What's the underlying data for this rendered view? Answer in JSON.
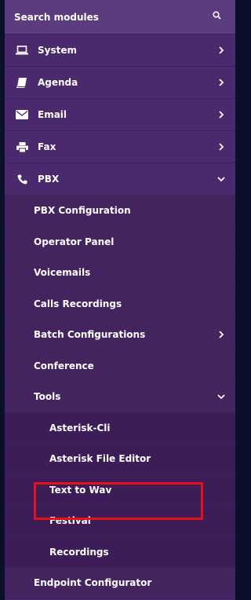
{
  "search": {
    "placeholder": "Search modules"
  },
  "top_items": [
    {
      "label": "System",
      "icon": "laptop-icon"
    },
    {
      "label": "Agenda",
      "icon": "book-icon"
    },
    {
      "label": "Email",
      "icon": "envelope-icon"
    },
    {
      "label": "Fax",
      "icon": "printer-icon"
    },
    {
      "label": "PBX",
      "icon": "phone-icon"
    }
  ],
  "pbx_items": [
    {
      "label": "PBX Configuration"
    },
    {
      "label": "Operator Panel"
    },
    {
      "label": "Voicemails"
    },
    {
      "label": "Calls Recordings"
    },
    {
      "label": "Batch Configurations"
    },
    {
      "label": "Conference"
    },
    {
      "label": "Tools"
    }
  ],
  "tools_items": [
    {
      "label": "Asterisk-Cli"
    },
    {
      "label": "Asterisk File Editor"
    },
    {
      "label": "Text to Wav"
    },
    {
      "label": "Festival"
    },
    {
      "label": "Recordings"
    }
  ],
  "more_items": [
    {
      "label": "Endpoint Configurator"
    }
  ],
  "colors": {
    "menu_bg": "#4a2a6c",
    "search_bg": "#5b3d7f",
    "highlight": "#e8101a"
  }
}
